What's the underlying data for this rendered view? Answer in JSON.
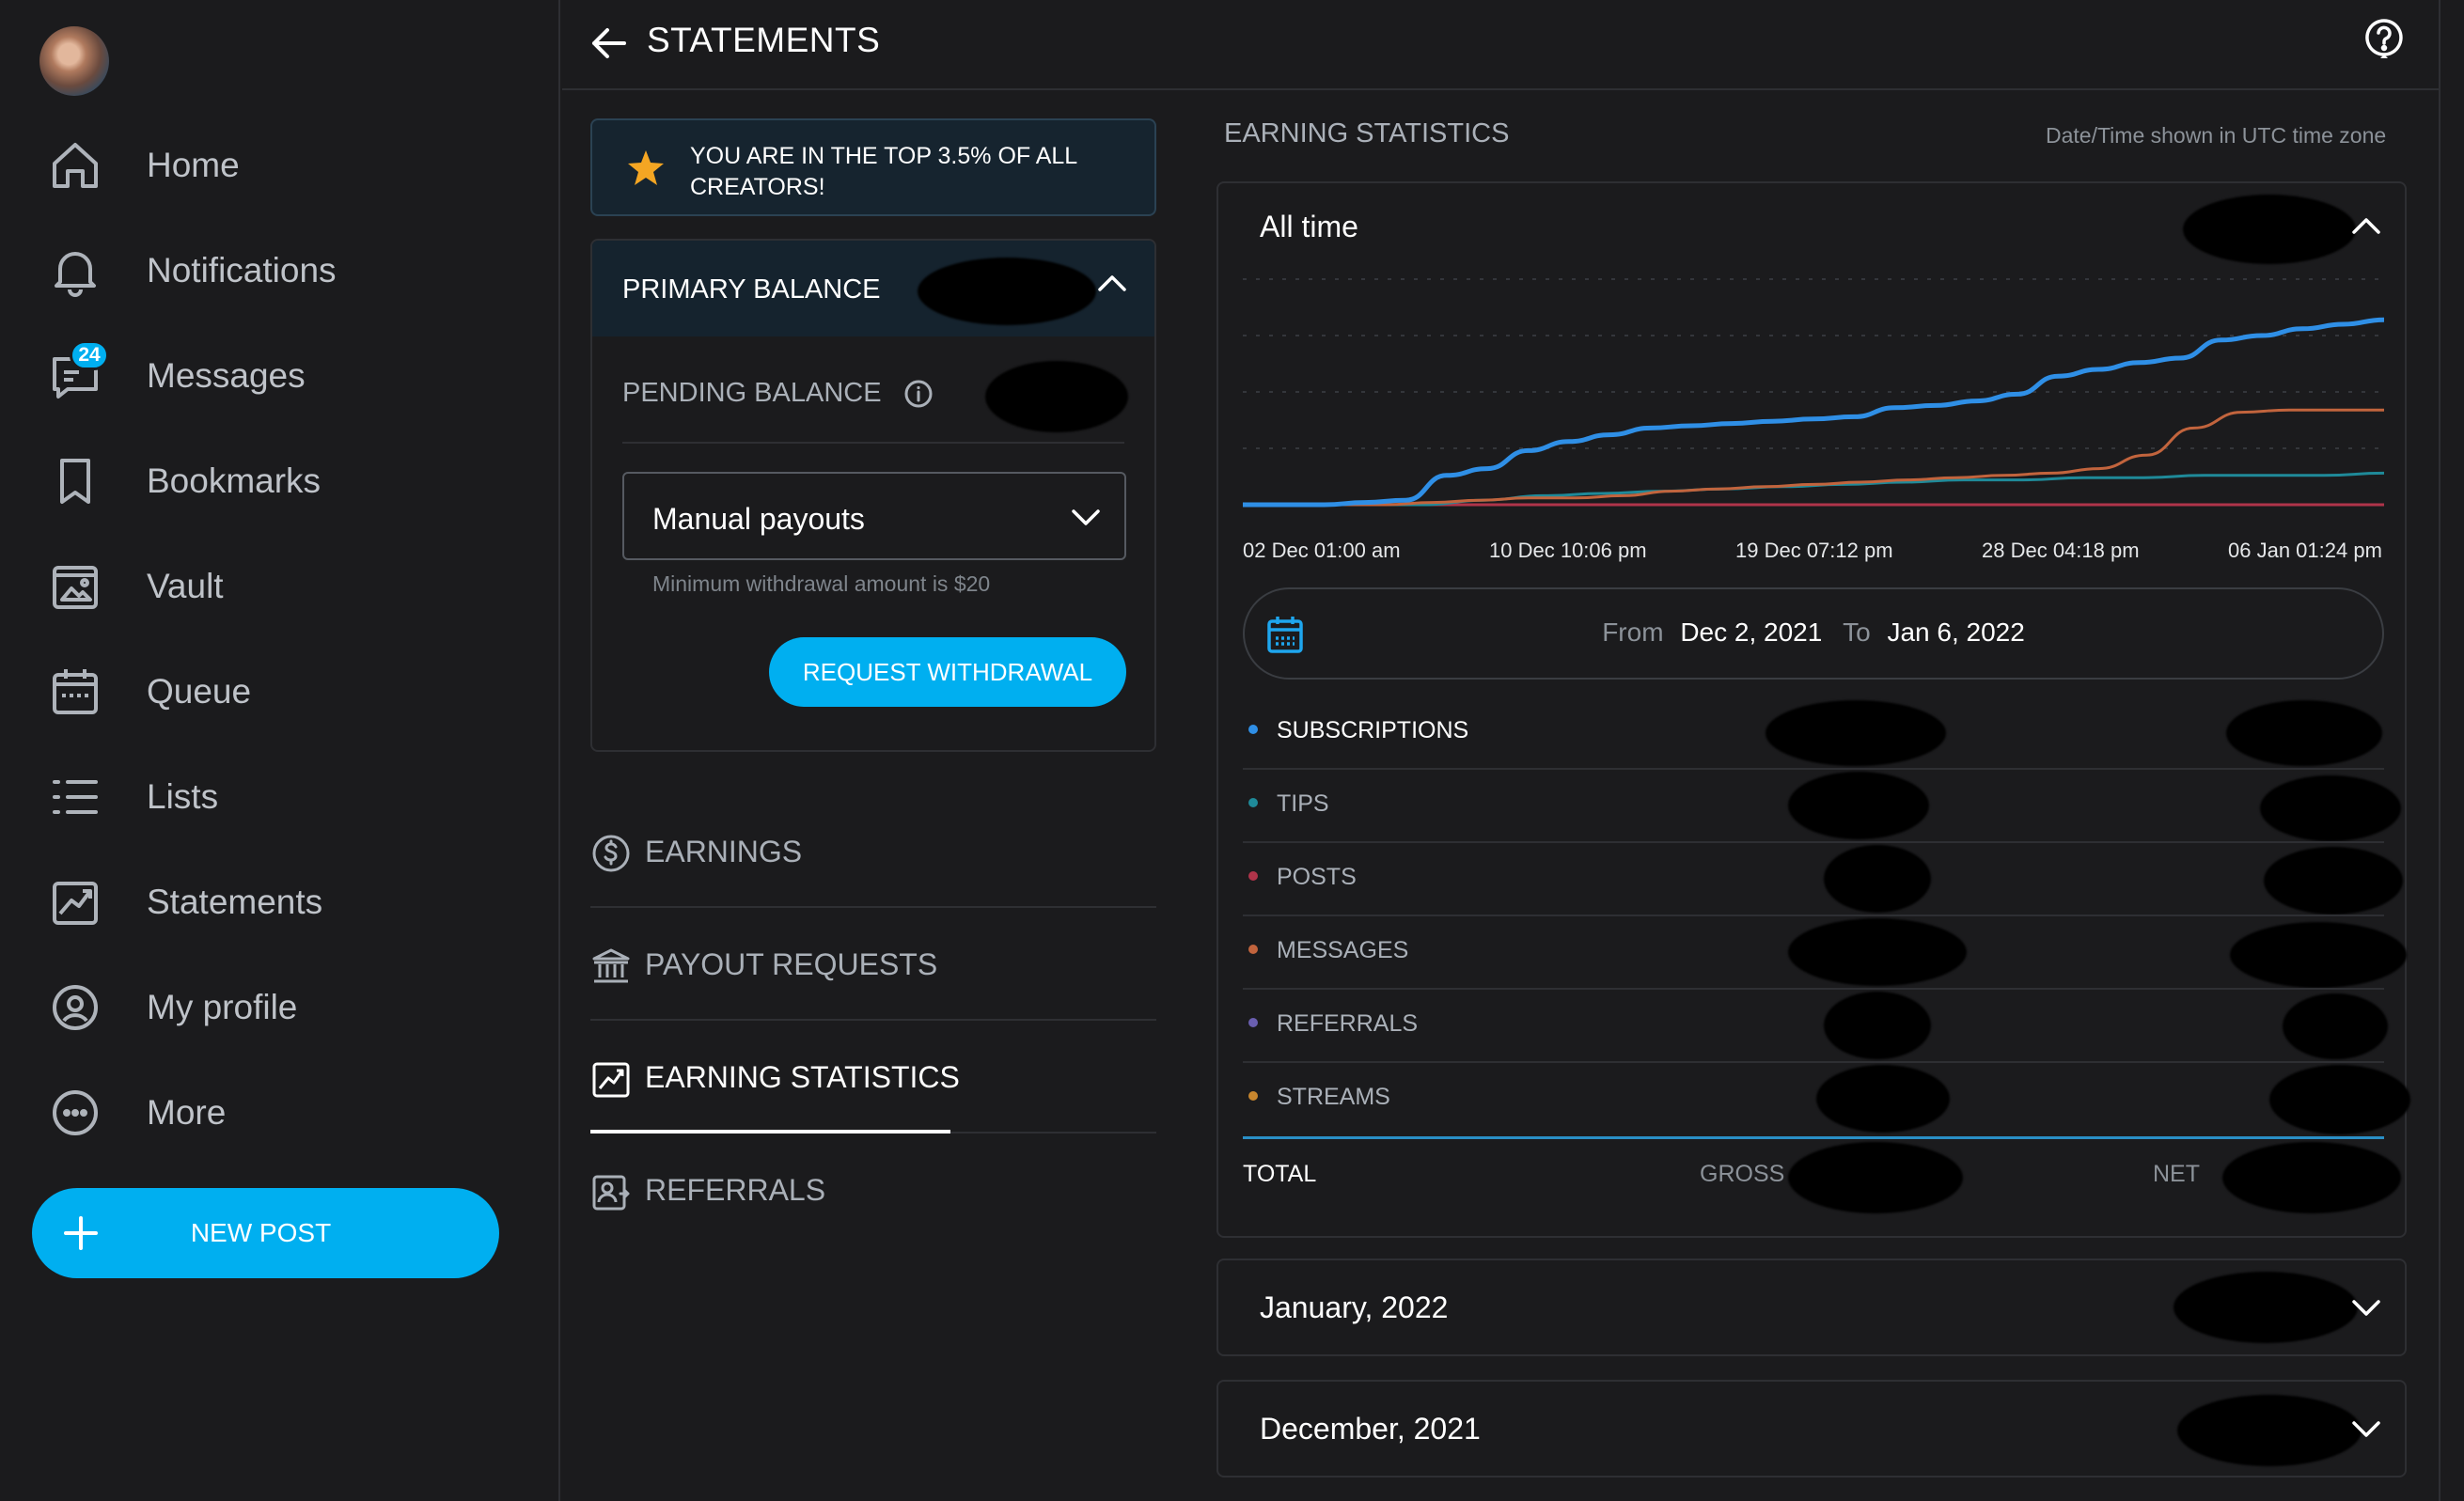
{
  "sidebar": {
    "items": [
      {
        "label": "Home",
        "icon": "home-icon"
      },
      {
        "label": "Notifications",
        "icon": "bell-icon"
      },
      {
        "label": "Messages",
        "icon": "chat-icon",
        "badge": "24"
      },
      {
        "label": "Bookmarks",
        "icon": "bookmark-icon"
      },
      {
        "label": "Vault",
        "icon": "image-icon"
      },
      {
        "label": "Queue",
        "icon": "calendar-icon"
      },
      {
        "label": "Lists",
        "icon": "list-icon"
      },
      {
        "label": "Statements",
        "icon": "chart-icon"
      },
      {
        "label": "My profile",
        "icon": "profile-icon"
      },
      {
        "label": "More",
        "icon": "more-icon"
      }
    ],
    "new_post_label": "NEW POST"
  },
  "header": {
    "title": "STATEMENTS"
  },
  "banner": {
    "text": "YOU ARE IN THE TOP 3.5% OF ALL CREATORS!"
  },
  "balance": {
    "primary_label": "PRIMARY BALANCE",
    "pending_label": "PENDING BALANCE",
    "payout_select_value": "Manual payouts",
    "min_note": "Minimum withdrawal amount is $20",
    "withdraw_label": "REQUEST WITHDRAWAL"
  },
  "menu": [
    {
      "label": "EARNINGS",
      "icon": "dollar-icon",
      "active": false
    },
    {
      "label": "PAYOUT REQUESTS",
      "icon": "bank-icon",
      "active": false
    },
    {
      "label": "EARNING STATISTICS",
      "icon": "chart-icon",
      "active": true
    },
    {
      "label": "REFERRALS",
      "icon": "referral-icon",
      "active": false
    }
  ],
  "stats": {
    "title": "EARNING STATISTICS",
    "timezone_note": "Date/Time shown in UTC time zone",
    "period_label": "All time",
    "date_range": {
      "from_label": "From",
      "from": "Dec 2, 2021",
      "to_label": "To",
      "to": "Jan 6, 2022"
    },
    "categories": [
      {
        "label": "SUBSCRIPTIONS",
        "color": "#2f8fe6"
      },
      {
        "label": "TIPS",
        "color": "#1f8a99"
      },
      {
        "label": "POSTS",
        "color": "#b0344a"
      },
      {
        "label": "MESSAGES",
        "color": "#c2643d"
      },
      {
        "label": "REFERRALS",
        "color": "#6a5fb0"
      },
      {
        "label": "STREAMS",
        "color": "#c7862e"
      }
    ],
    "total_label": "TOTAL",
    "gross_label": "GROSS",
    "net_label": "NET"
  },
  "chart_data": {
    "type": "line",
    "x_tick_labels": [
      "02 Dec 01:00 am",
      "10 Dec 10:06 pm",
      "19 Dec 07:12 pm",
      "28 Dec 04:18 pm",
      "06 Jan 01:24 pm"
    ],
    "grid": true,
    "legend": "none",
    "series": [
      {
        "color": "#2f8fe6",
        "values": [
          0,
          0,
          0,
          0.01,
          0.02,
          0.13,
          0.16,
          0.24,
          0.28,
          0.31,
          0.34,
          0.35,
          0.36,
          0.37,
          0.38,
          0.39,
          0.43,
          0.44,
          0.46,
          0.49,
          0.57,
          0.6,
          0.63,
          0.65,
          0.73,
          0.75,
          0.78,
          0.8,
          0.82
        ]
      },
      {
        "color": "#c2643d",
        "values": [
          0,
          0,
          0,
          0,
          0.01,
          0.02,
          0.03,
          0.03,
          0.04,
          0.06,
          0.07,
          0.08,
          0.09,
          0.1,
          0.11,
          0.12,
          0.13,
          0.14,
          0.16,
          0.22,
          0.34,
          0.41,
          0.42,
          0.42,
          0.42
        ]
      },
      {
        "color": "#1f8a99",
        "values": [
          0,
          0,
          0,
          0,
          0.02,
          0.04,
          0.05,
          0.06,
          0.07,
          0.08,
          0.09,
          0.1,
          0.11,
          0.11,
          0.12,
          0.12,
          0.13,
          0.13,
          0.13,
          0.14
        ]
      },
      {
        "color": "#b0344a",
        "values": [
          0,
          0,
          0,
          0,
          0,
          0,
          0,
          0,
          0,
          0,
          0,
          0
        ]
      }
    ]
  },
  "months": [
    {
      "label": "January, 2022"
    },
    {
      "label": "December, 2021"
    }
  ]
}
